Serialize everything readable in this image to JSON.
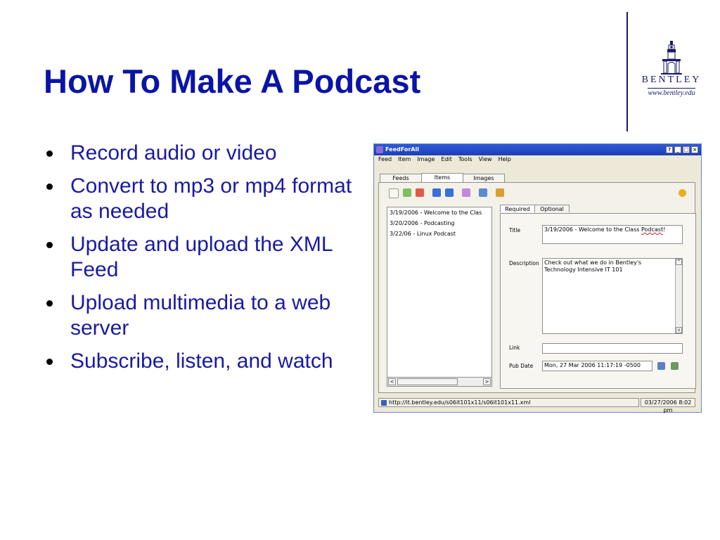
{
  "slide": {
    "title": "How To Make A Podcast",
    "bullets": [
      "Record audio or video",
      "Convert to mp3 or mp4 format as needed",
      "Update and upload the XML Feed",
      "Upload multimedia to a web server",
      "Subscribe, listen, and watch"
    ],
    "logo": {
      "name": "BENTLEY",
      "url": "www.bentley.edu"
    }
  },
  "app": {
    "window_title": "FeedForAll",
    "menu": [
      "Feed",
      "Item",
      "Image",
      "Edit",
      "Tools",
      "View",
      "Help"
    ],
    "tabs": [
      "Feeds",
      "Items",
      "Images"
    ],
    "active_tab": "Items",
    "items": [
      "3/19/2006 - Welcome to the Clas",
      "3/20/2006 - Podcasting",
      "3/22/06 - Linux Podcast"
    ],
    "subtabs": [
      "Required",
      "Optional"
    ],
    "form": {
      "title_label": "Title",
      "title_value_prefix": "3/19/2006 - Welcome to the Class ",
      "title_value_word": "Podcast",
      "title_value_suffix": "!",
      "description_label": "Description",
      "description_value": "Check out what we do in Bentley's Technology Intensive IT 101",
      "link_label": "Link",
      "link_value": "",
      "pubdate_label": "Pub Date",
      "pubdate_value": "Mon, 27 Mar 2006 11:17:19 -0500"
    },
    "status": {
      "url": "http://it.bentley.edu/s06it101x11/s06it101x11.xml",
      "date": "03/27/2006 8:02 pm"
    },
    "colors": {
      "titlebar": "#2e5bd8",
      "title_text": "#0a14a6",
      "bullet_text": "#1a1aa0"
    }
  }
}
